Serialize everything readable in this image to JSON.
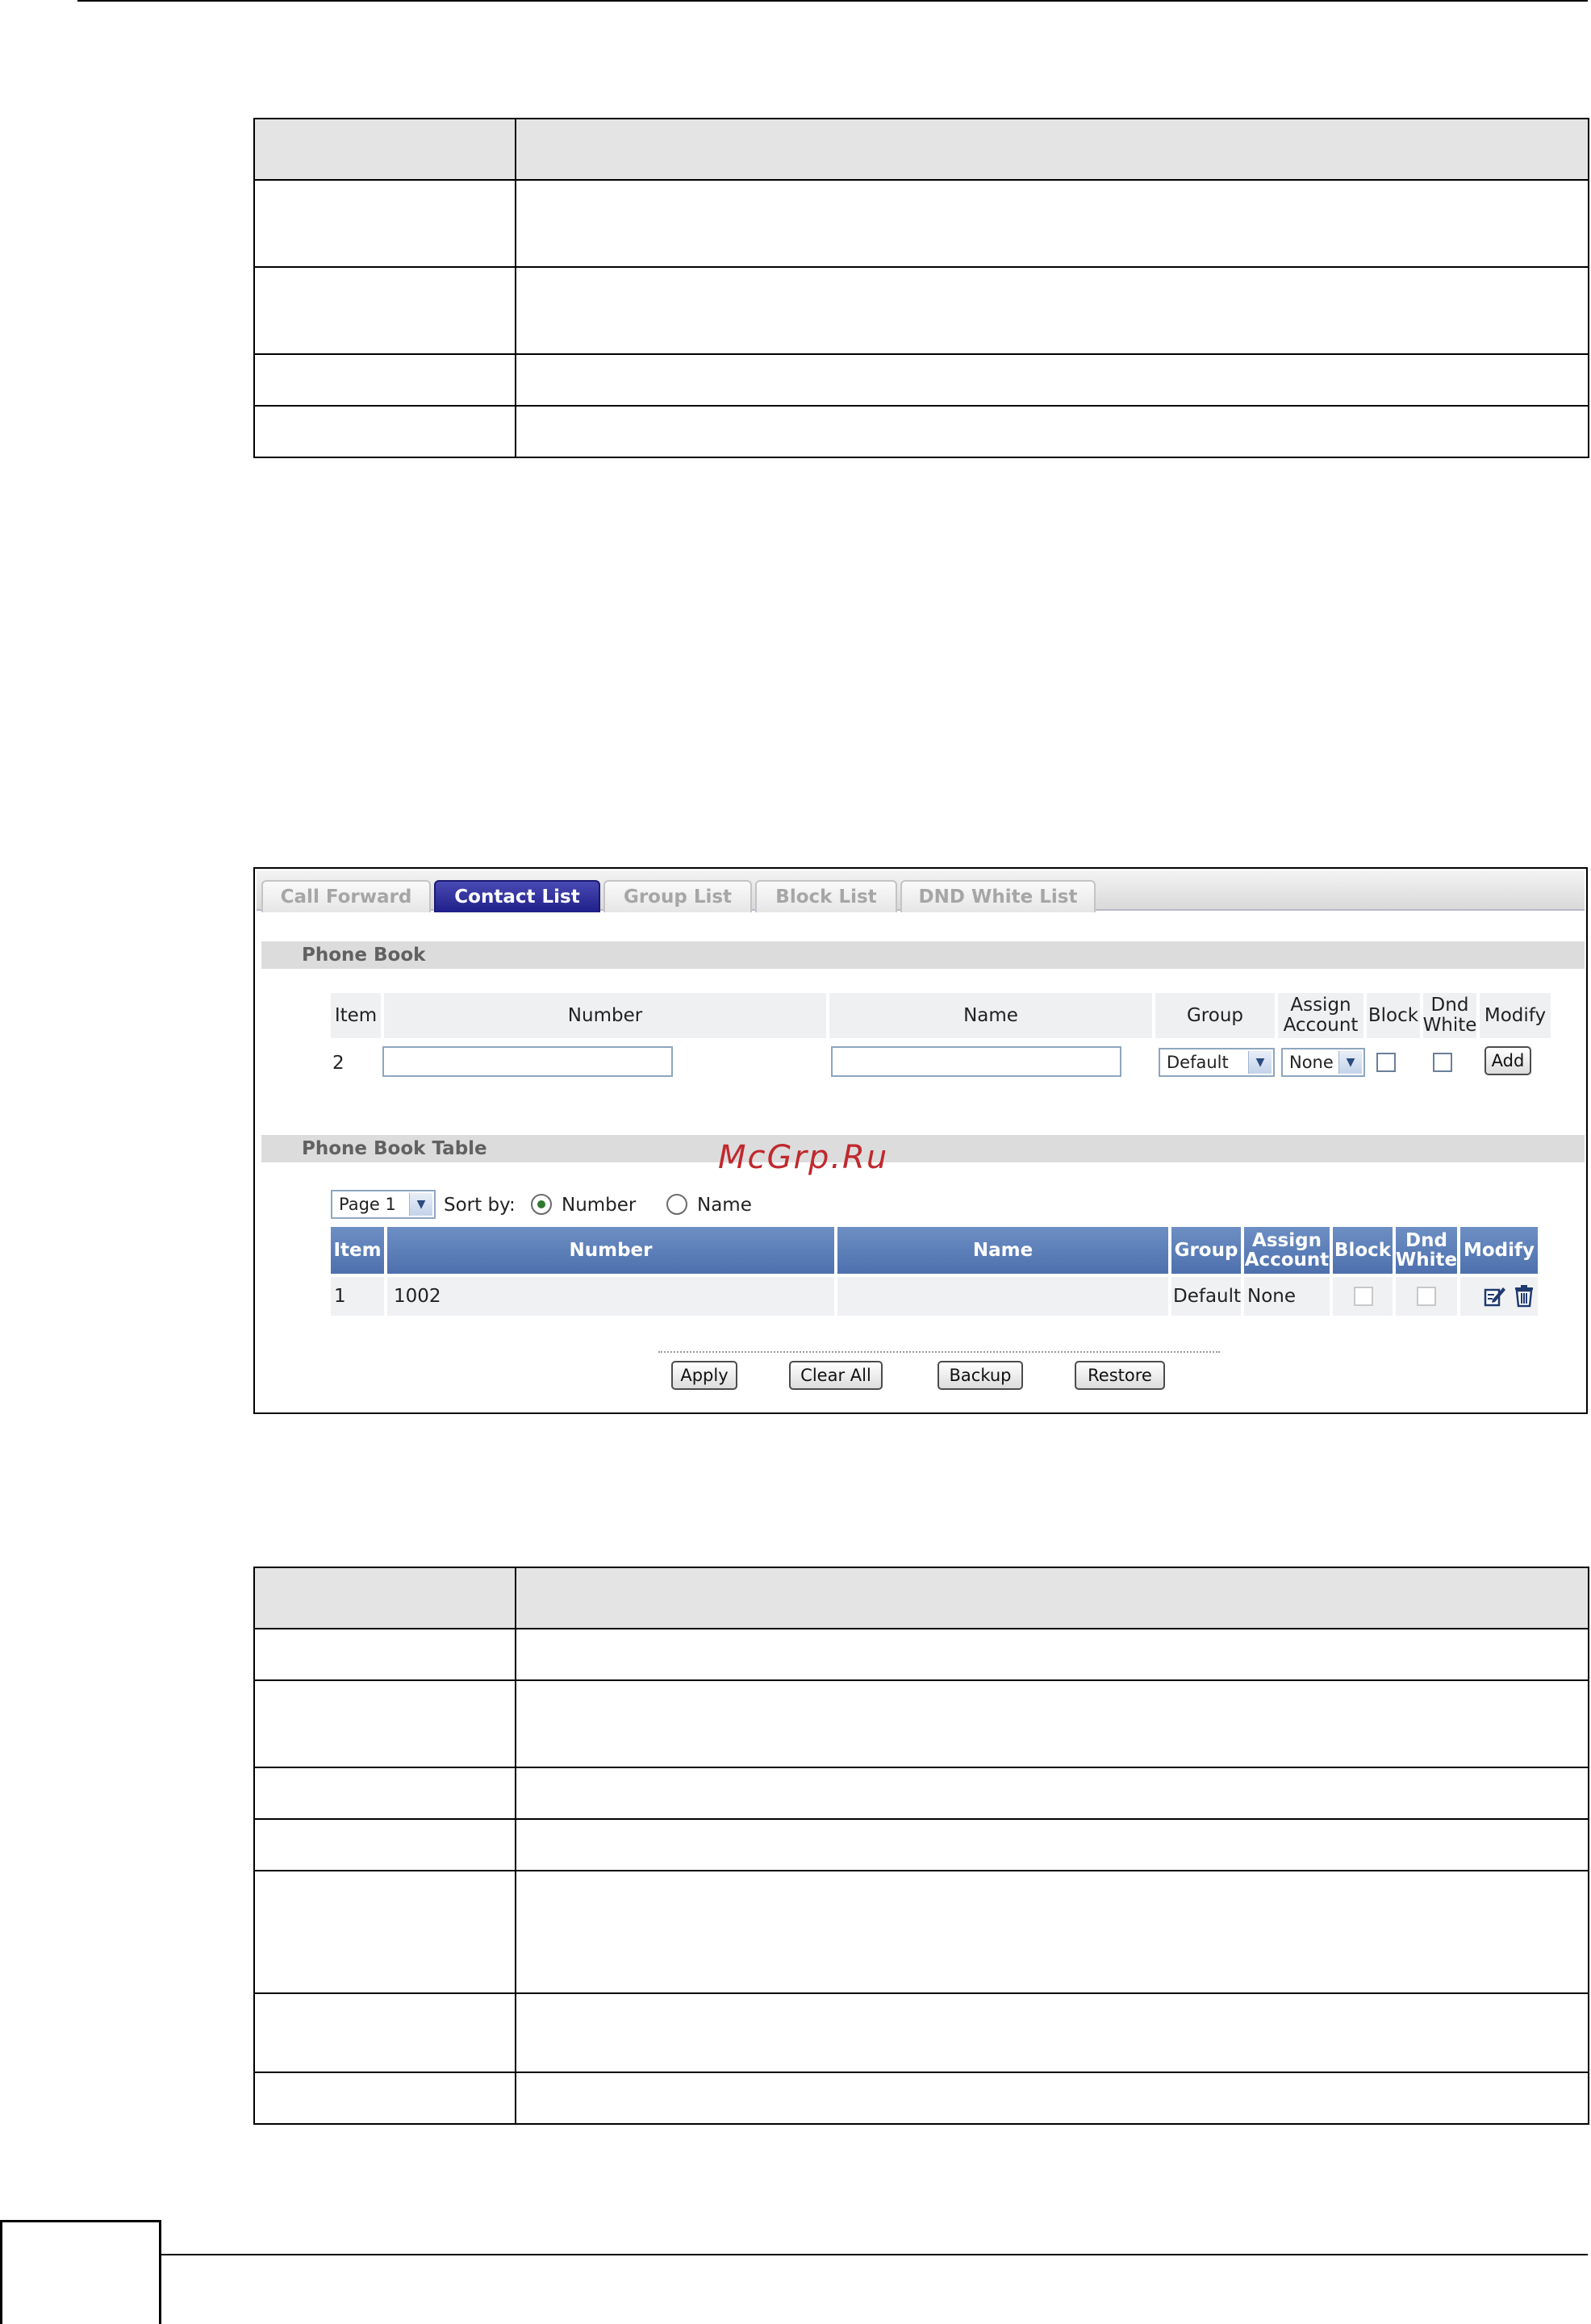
{
  "tabs": [
    {
      "label": "Call Forward",
      "active": false
    },
    {
      "label": "Contact List",
      "active": true
    },
    {
      "label": "Group List",
      "active": false
    },
    {
      "label": "Block List",
      "active": false
    },
    {
      "label": "DND White List",
      "active": false
    }
  ],
  "phone_book": {
    "section_title": "Phone Book",
    "headers": {
      "item": "Item",
      "number": "Number",
      "name": "Name",
      "group": "Group",
      "assign_account": "Assign Account",
      "block": "Block",
      "dnd_white": "Dnd White",
      "modify": "Modify"
    },
    "row": {
      "item": "2",
      "number_value": "",
      "name_value": "",
      "group_selected": "Default",
      "account_selected": "None",
      "block_checked": false,
      "dnd_white_checked": false,
      "add_label": "Add"
    }
  },
  "phone_book_table": {
    "section_title": "Phone Book Table",
    "page_selected": "Page 1",
    "sort_by_label": "Sort by:",
    "sort_options": [
      {
        "label": "Number",
        "selected": true
      },
      {
        "label": "Name",
        "selected": false
      }
    ],
    "headers": {
      "item": "Item",
      "number": "Number",
      "name": "Name",
      "group": "Group",
      "assign_account": "Assign Account",
      "block": "Block",
      "dnd_white": "Dnd White",
      "modify": "Modify"
    },
    "rows": [
      {
        "item": "1",
        "number": "1002",
        "name": "",
        "group": "Default",
        "account": "None"
      }
    ]
  },
  "buttons": {
    "apply": "Apply",
    "clear_all": "Clear All",
    "backup": "Backup",
    "restore": "Restore"
  },
  "watermark": "McGrp.Ru"
}
